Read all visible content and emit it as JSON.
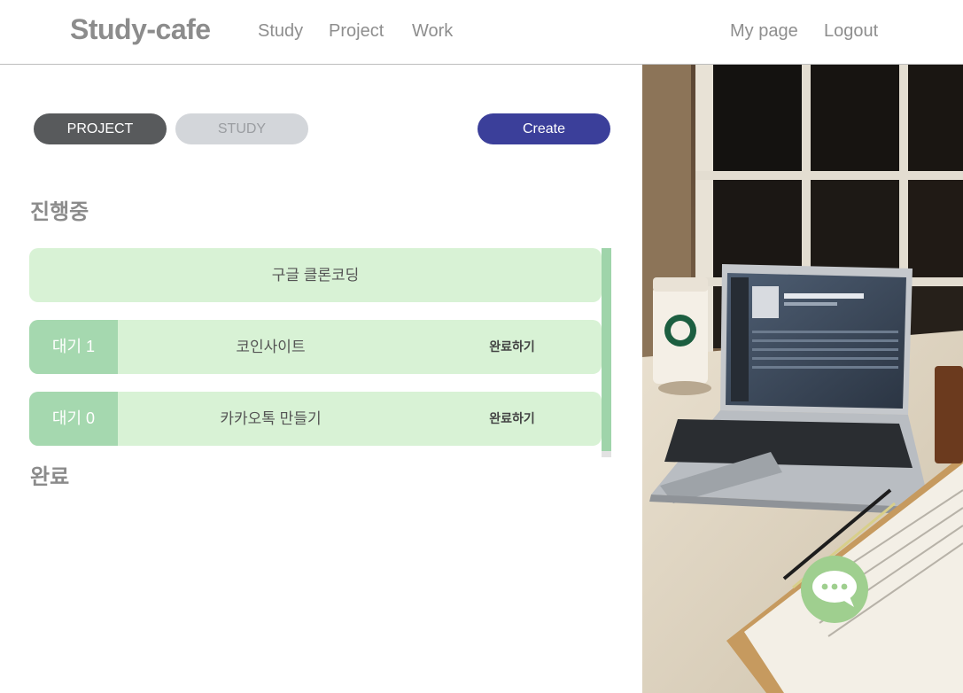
{
  "navbar": {
    "brand": "Study-cafe",
    "links": [
      "Study",
      "Project",
      "Work"
    ],
    "right_links": [
      "My page",
      "Logout"
    ]
  },
  "tabs": {
    "project": "PROJECT",
    "study": "STUDY",
    "create": "Create"
  },
  "sections": {
    "in_progress": "진행중",
    "completed": "완료"
  },
  "cards": [
    {
      "title": "구글 클론코딩"
    },
    {
      "badge": "대기 1",
      "title": "코인사이트",
      "action": "완료하기"
    },
    {
      "badge": "대기 0",
      "title": "카카오톡 만들기",
      "action": "완료하기"
    }
  ],
  "colors": {
    "card_bg": "#d8f2d5",
    "badge_bg": "#a5d8af",
    "create_button": "#3b3f9a",
    "active_tab": "#585a5c",
    "chat_button": "#9fcf8f"
  },
  "icons": {
    "chat": "speech-bubble-icon"
  }
}
